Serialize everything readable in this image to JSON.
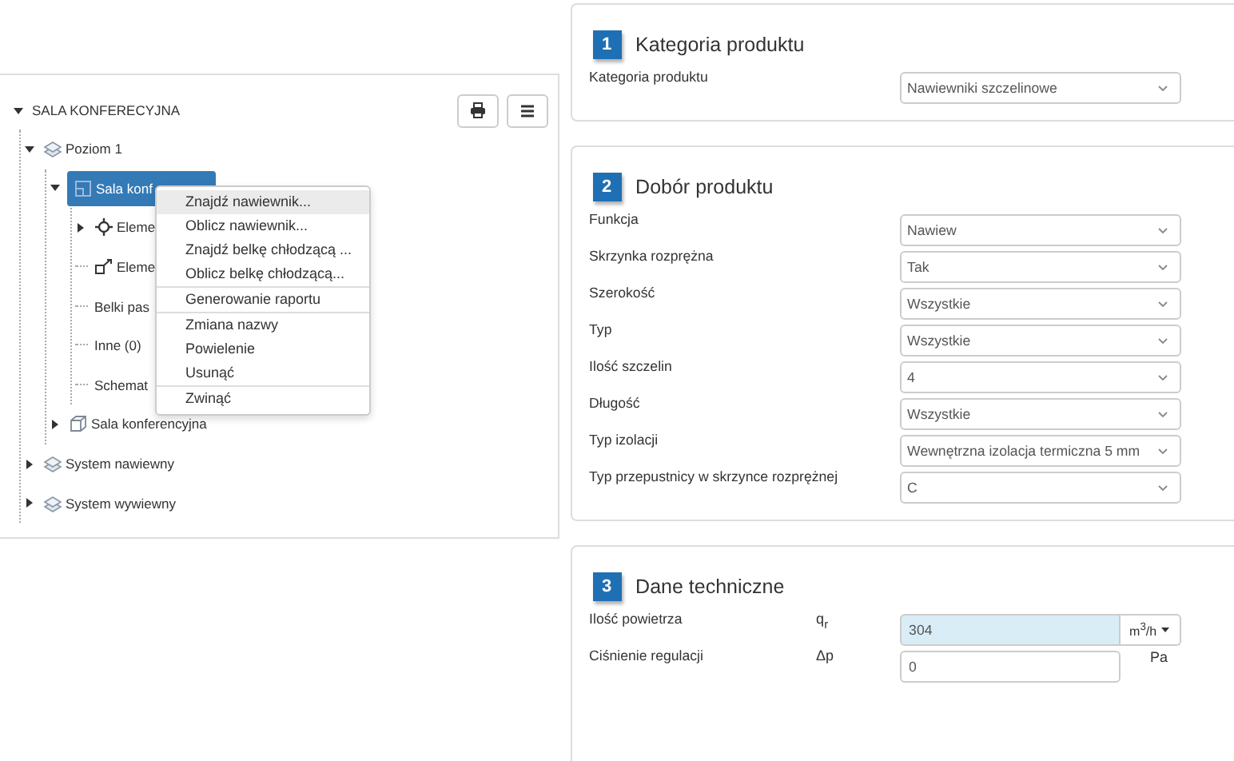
{
  "tree": {
    "label": "SALA KONFERECYJNA",
    "expanded": true,
    "selected": false,
    "children": [
      {
        "label": "Poziom 1",
        "kind": "layers",
        "expanded": true,
        "selected": false,
        "children": [
          {
            "label": "Sala konf",
            "kind": "room",
            "expanded": true,
            "selected": true,
            "children": [
              {
                "label": "Eleme",
                "kind": "target",
                "expanded": false,
                "selected": false
              },
              {
                "label": "Eleme",
                "kind": "connector",
                "selected": false
              },
              {
                "label": "Belki pas",
                "kind": "plain",
                "selected": false
              },
              {
                "label": "Inne (0)",
                "kind": "plain",
                "selected": false
              },
              {
                "label": "Schemat",
                "kind": "plain",
                "selected": false
              }
            ]
          },
          {
            "label": "Sala konferencyjna",
            "kind": "box",
            "expanded": false,
            "selected": false
          }
        ]
      },
      {
        "label": "System nawiewny",
        "kind": "layers",
        "expanded": false,
        "selected": false
      },
      {
        "label": "System wywiewny",
        "kind": "layers",
        "expanded": false,
        "selected": false
      }
    ]
  },
  "tree_buttons": [
    {
      "kind": "print"
    },
    {
      "kind": "menu"
    }
  ],
  "context_menu": {
    "groups": [
      [
        {
          "label": "Znajdź nawiewnik...",
          "highlighted": true
        },
        {
          "label": "Oblicz nawiewnik...",
          "highlighted": false
        },
        {
          "label": "Znajdź belkę chłodzącą ...",
          "highlighted": false
        },
        {
          "label": "Oblicz belkę chłodzącą...",
          "highlighted": false
        }
      ],
      [
        {
          "label": "Generowanie raportu",
          "highlighted": false
        }
      ],
      [
        {
          "label": "Zmiana nazwy",
          "highlighted": false
        },
        {
          "label": "Powielenie",
          "highlighted": false
        },
        {
          "label": "Usunąć",
          "highlighted": false
        }
      ],
      [
        {
          "label": "Zwinąć",
          "highlighted": false
        }
      ]
    ]
  },
  "sections": [
    {
      "number": "1",
      "title": "Kategoria produktu",
      "fields": [
        {
          "kind": "select",
          "label": "Kategoria produktu",
          "value": "Nawiewniki szczelinowe"
        }
      ]
    },
    {
      "number": "2",
      "title": "Dobór produktu",
      "fields": [
        {
          "kind": "select",
          "label": "Funkcja",
          "value": "Nawiew"
        },
        {
          "kind": "select",
          "label": "Skrzynka rozprężna",
          "value": "Tak"
        },
        {
          "kind": "select",
          "label": "Szerokość",
          "value": "Wszystkie"
        },
        {
          "kind": "select",
          "label": "Typ",
          "value": "Wszystkie"
        },
        {
          "kind": "select",
          "label": "Ilość szczelin",
          "value": "4"
        },
        {
          "kind": "select",
          "label": "Długość",
          "value": "Wszystkie"
        },
        {
          "kind": "select",
          "label": "Typ izolacji",
          "value": "Wewnętrzna izolacja termiczna 5 mm"
        },
        {
          "kind": "select",
          "label": "Typ przepustnicy w skrzynce rozprężnej",
          "value": "C"
        }
      ]
    },
    {
      "number": "3",
      "title": "Dane techniczne",
      "fields": [
        {
          "kind": "quantity-menu",
          "label": "Ilość powietrza",
          "symbol": "q$_{r}$",
          "value": "304",
          "unit": "m$^{3}$/h",
          "highlighted": true
        },
        {
          "kind": "quantity",
          "label": "Ciśnienie regulacji",
          "symbol": "Δp",
          "value": "0",
          "unit": "Pa",
          "highlighted": false
        }
      ]
    }
  ]
}
